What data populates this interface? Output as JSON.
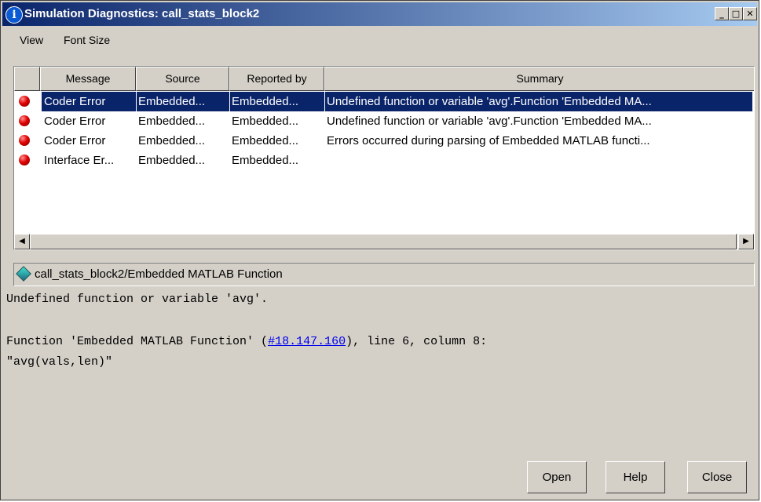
{
  "window": {
    "title": "Simulation Diagnostics: call_stats_block2",
    "title_icon_glyph": "i",
    "controls": {
      "minimize": "_",
      "maximize": "□",
      "close": "✕"
    }
  },
  "menubar": {
    "items": [
      {
        "label": "View"
      },
      {
        "label": "Font Size"
      }
    ]
  },
  "table": {
    "columns": [
      "",
      "Message",
      "Source",
      "Reported by",
      "Summary"
    ],
    "rows": [
      {
        "message": "Coder Error",
        "source": "Embedded...",
        "reported_by": "Embedded...",
        "summary": "Undefined function or variable 'avg'.Function 'Embedded MA...",
        "selected": true
      },
      {
        "message": "Coder Error",
        "source": "Embedded...",
        "reported_by": "Embedded...",
        "summary": "Undefined function or variable 'avg'.Function 'Embedded MA..."
      },
      {
        "message": "Coder Error",
        "source": "Embedded...",
        "reported_by": "Embedded...",
        "summary": "Errors occurred during parsing of Embedded MATLAB functi..."
      },
      {
        "message": "Interface Er...",
        "source": "Embedded...",
        "reported_by": "Embedded...",
        "summary": ""
      }
    ],
    "scroll_left": "◀",
    "scroll_right": "▶"
  },
  "path_bar": {
    "icon": "block-diamond-icon",
    "text": "call_stats_block2/Embedded MATLAB Function"
  },
  "details": {
    "line1": "Undefined function or variable 'avg'.",
    "line2_prefix": "Function 'Embedded MATLAB Function' (",
    "line2_link": "#18.147.160",
    "line2_suffix": "), line 6, column 8:",
    "line3": "\"avg(vals,len)\""
  },
  "buttons": {
    "open": "Open",
    "help": "Help",
    "close": "Close"
  },
  "colors": {
    "selection": "#0a246a",
    "error_dot": "#e00000",
    "link": "#0000ee"
  }
}
